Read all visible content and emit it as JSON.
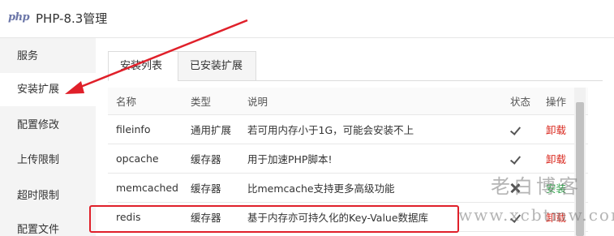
{
  "app": {
    "logo_text": "php",
    "title": "PHP-8.3管理"
  },
  "sidebar": {
    "items": [
      {
        "label": "服务"
      },
      {
        "label": "安装扩展"
      },
      {
        "label": "配置修改"
      },
      {
        "label": "上传限制"
      },
      {
        "label": "超时限制"
      },
      {
        "label": "配置文件"
      }
    ]
  },
  "tabs": [
    {
      "label": "安装列表"
    },
    {
      "label": "已安装扩展"
    }
  ],
  "table": {
    "headers": {
      "name": "名称",
      "type": "类型",
      "desc": "说明",
      "status": "状态",
      "op": "操作"
    },
    "rows": [
      {
        "name": "fileinfo",
        "type": "通用扩展",
        "desc": "若可用内存小于1G，可能会安装不上",
        "status_icon": "check-icon",
        "op": "卸载"
      },
      {
        "name": "opcache",
        "type": "缓存器",
        "desc": "用于加速PHP脚本!",
        "status_icon": "check-icon",
        "op": "卸载"
      },
      {
        "name": "memcached",
        "type": "缓存器",
        "desc": "比memcache支持更多高级功能",
        "status_icon": "cross-icon",
        "op": "安装"
      },
      {
        "name": "redis",
        "type": "缓存器",
        "desc": "基于内存亦可持久化的Key-Value数据库",
        "status_icon": "check-icon",
        "op": "卸载"
      }
    ]
  },
  "watermark": {
    "line1": "老白博客",
    "line2": "www.xcbtmw.com"
  },
  "colors": {
    "uninstall": "#d9281e",
    "install": "#2aa046",
    "annotation": "#e0202a"
  }
}
